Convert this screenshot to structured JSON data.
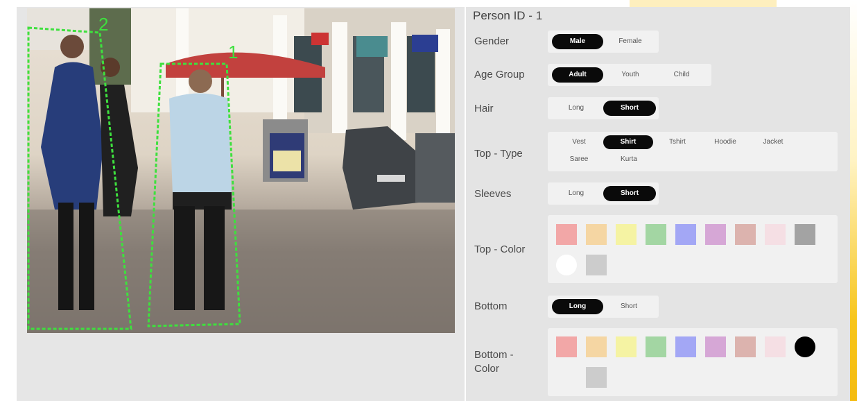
{
  "video": {
    "boxes": [
      {
        "id": "1"
      },
      {
        "id": "2"
      }
    ]
  },
  "form": {
    "title": "Person ID - 1",
    "gender": {
      "label": "Gender",
      "options": [
        "Male",
        "Female"
      ],
      "selected": "Male"
    },
    "age_group": {
      "label": "Age Group",
      "options": [
        "Adult",
        "Youth",
        "Child"
      ],
      "selected": "Adult"
    },
    "hair": {
      "label": "Hair",
      "options": [
        "Long",
        "Short"
      ],
      "selected": "Short"
    },
    "top_type": {
      "label": "Top - Type",
      "options": [
        "Vest",
        "Shirt",
        "Tshirt",
        "Hoodie",
        "Jacket",
        "Saree",
        "Kurta"
      ],
      "selected": "Shirt"
    },
    "sleeves": {
      "label": "Sleeves",
      "options": [
        "Long",
        "Short"
      ],
      "selected": "Short"
    },
    "top_color": {
      "label": "Top - Color",
      "swatches": [
        "#f2a7a7",
        "#f5d6a3",
        "#f5f3a3",
        "#a3d6a3",
        "#a3a7f5",
        "#d6a7d6",
        "#dcb3ae",
        "#f5dfe4",
        "#a3a3a3",
        "#ffffff",
        "#cccccc"
      ]
    },
    "bottom": {
      "label": "Bottom",
      "options": [
        "Long",
        "Short"
      ],
      "selected": "Long"
    },
    "bottom_color": {
      "label": "Bottom -\nColor",
      "swatches": [
        "#f2a7a7",
        "#f5d6a3",
        "#f5f3a3",
        "#a3d6a3",
        "#a3a7f5",
        "#d6a7d6",
        "#dcb3ae",
        "#f5dfe4",
        "#000000",
        "#f1f1f1",
        "#cccccc"
      ],
      "selected_index": 8
    }
  }
}
